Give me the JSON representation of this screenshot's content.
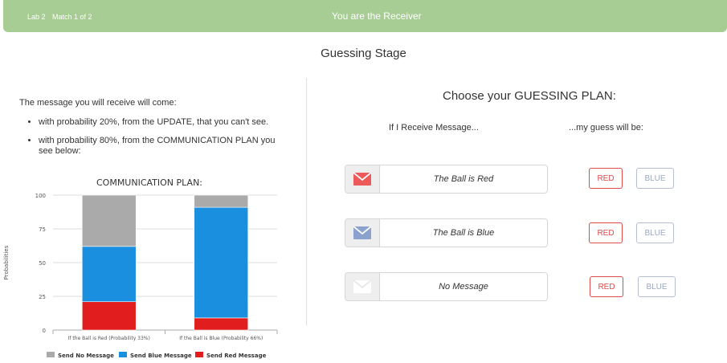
{
  "header": {
    "lab": "Lab 2",
    "match": "Match 1 of 2",
    "role": "You are the Receiver"
  },
  "stage_title": "Guessing Stage",
  "left": {
    "intro": "The message you will receive will come:",
    "bullets": [
      "with probability 20%, from the UPDATE, that you can't see.",
      "with probability 80%, from the COMMUNICATION PLAN you see below:"
    ]
  },
  "chart_data": {
    "type": "bar",
    "stacked": true,
    "title": "COMMUNICATION PLAN:",
    "ylabel": "Probabilities",
    "xlabel": "",
    "ylim": [
      0,
      100
    ],
    "yticks": [
      0,
      25,
      50,
      75,
      100
    ],
    "grid": true,
    "legend_position": "bottom",
    "categories": [
      "If the Ball is Red (Probability 33%)",
      "If the Ball is Blue (Probability 66%)"
    ],
    "series": [
      {
        "name": "Send Red Message",
        "color": "#e21d1d",
        "values": [
          21,
          9
        ]
      },
      {
        "name": "Send Blue Message",
        "color": "#1a8fdf",
        "values": [
          41,
          82
        ]
      },
      {
        "name": "Send No Message",
        "color": "#aaaaaa",
        "values": [
          38,
          9
        ]
      }
    ],
    "legend_order": [
      "Send No Message",
      "Send Blue Message",
      "Send Red Message"
    ]
  },
  "right": {
    "title": "Choose your GUESSING PLAN:",
    "col_left": "If I Receive Message...",
    "col_right": "...my guess will be:",
    "rows": [
      {
        "message": "The Ball is Red",
        "icon": "red-envelope-icon",
        "icon_color": "#ec5a5a",
        "red_label": "RED",
        "blue_label": "BLUE"
      },
      {
        "message": "The Ball is Blue",
        "icon": "blue-envelope-icon",
        "icon_color": "#8ba2cf",
        "red_label": "RED",
        "blue_label": "BLUE"
      },
      {
        "message": "No Message",
        "icon": "blank-envelope-icon",
        "icon_color": "#ffffff",
        "red_label": "RED",
        "blue_label": "BLUE"
      }
    ]
  }
}
